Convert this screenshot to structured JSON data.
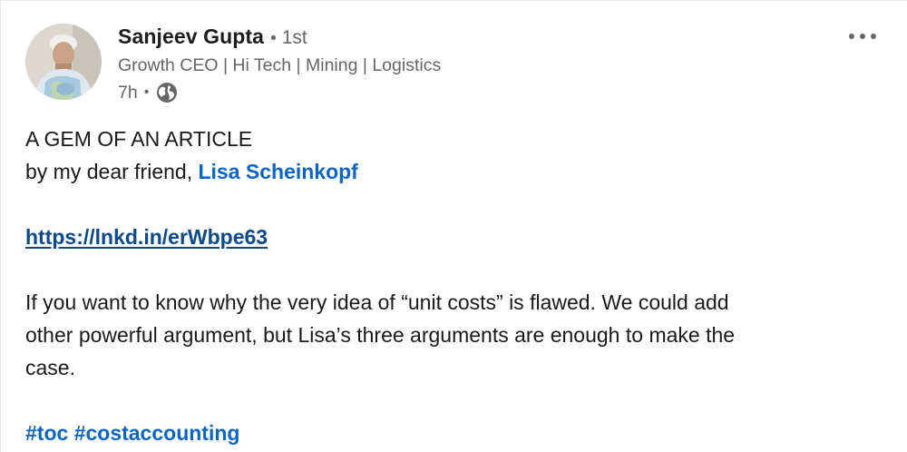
{
  "post": {
    "author": {
      "name": "Sanjeev Gupta",
      "degree": "1st",
      "separator": "•",
      "headline": "Growth CEO | Hi Tech | Mining | Logistics",
      "time": "7h",
      "time_separator": "•",
      "visibility_icon": "globe-icon"
    },
    "more_icon": "more-options-icon",
    "body": {
      "line1": "A GEM OF AN ARTICLE",
      "line2_prefix": "by my dear friend, ",
      "mention": "Lisa Scheinkopf",
      "link": "https://lnkd.in/erWbpe63",
      "para_line1": "If you want to know why the very idea of “unit costs” is flawed. We could add",
      "para_line2": "other powerful argument, but Lisa’s three arguments are enough to make the",
      "para_line3": "case.",
      "hashtags": [
        "#toc",
        "#costaccounting"
      ]
    }
  },
  "colors": {
    "link_blue": "#0a66c2",
    "url_blue": "#0a4a8c",
    "secondary_text": "#666666",
    "primary_text": "#191919"
  }
}
